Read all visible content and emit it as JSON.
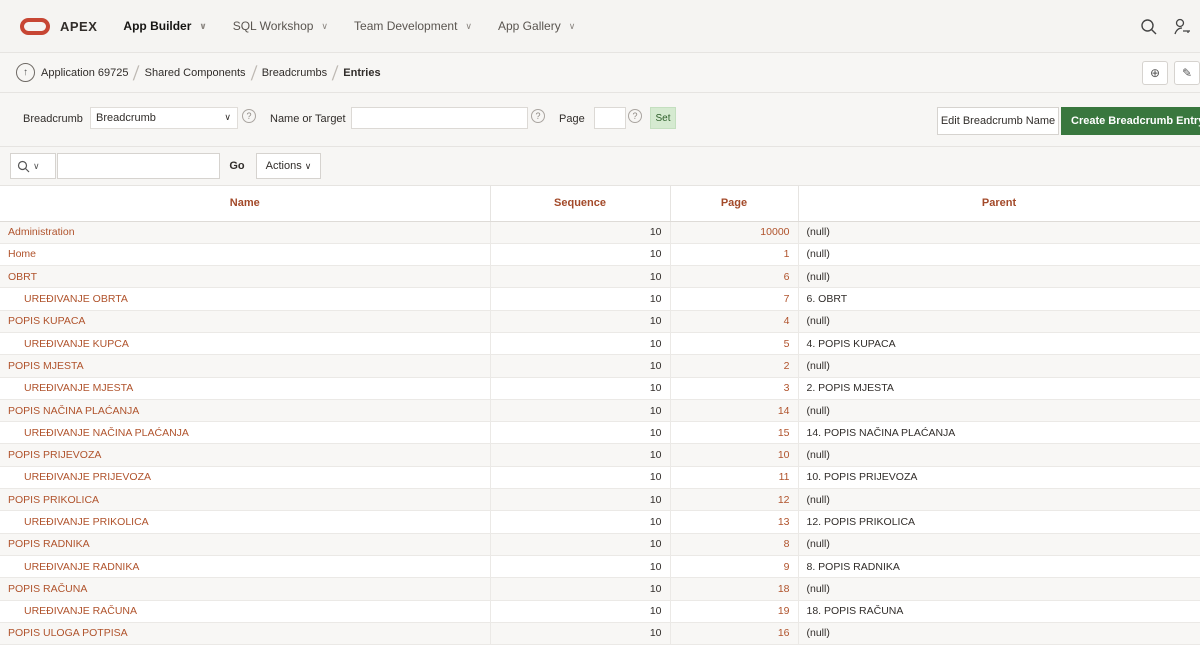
{
  "topnav": {
    "logo": "APEX",
    "items": [
      {
        "label": "App Builder",
        "active": true
      },
      {
        "label": "SQL Workshop",
        "active": false
      },
      {
        "label": "Team Development",
        "active": false
      },
      {
        "label": "App Gallery",
        "active": false
      }
    ]
  },
  "breadcrumb": {
    "items": [
      "Application 69725",
      "Shared Components",
      "Breadcrumbs",
      "Entries"
    ]
  },
  "filters": {
    "breadcrumb_label": "Breadcrumb",
    "breadcrumb_value": "Breadcrumb",
    "name_target_label": "Name or Target",
    "name_target_value": "",
    "page_label": "Page",
    "page_value": "",
    "set_label": "Set",
    "help_glyph": "?",
    "edit_button": "Edit Breadcrumb Name",
    "create_button": "Create Breadcrumb Entry >"
  },
  "search": {
    "value": "",
    "go_label": "Go",
    "actions_label": "Actions"
  },
  "table": {
    "columns": [
      "Name",
      "Sequence",
      "Page",
      "Parent"
    ],
    "rows": [
      {
        "name": "Administration",
        "child": false,
        "sequence": "10",
        "page": "10000",
        "parent": "(null)"
      },
      {
        "name": "Home",
        "child": false,
        "sequence": "10",
        "page": "1",
        "parent": "(null)"
      },
      {
        "name": "OBRT",
        "child": false,
        "sequence": "10",
        "page": "6",
        "parent": "(null)"
      },
      {
        "name": "UREĐIVANJE OBRTA",
        "child": true,
        "sequence": "10",
        "page": "7",
        "parent": "6. OBRT"
      },
      {
        "name": "POPIS KUPACA",
        "child": false,
        "sequence": "10",
        "page": "4",
        "parent": "(null)"
      },
      {
        "name": "UREĐIVANJE KUPCA",
        "child": true,
        "sequence": "10",
        "page": "5",
        "parent": "4. POPIS KUPACA"
      },
      {
        "name": "POPIS MJESTA",
        "child": false,
        "sequence": "10",
        "page": "2",
        "parent": "(null)"
      },
      {
        "name": "UREĐIVANJE MJESTA",
        "child": true,
        "sequence": "10",
        "page": "3",
        "parent": "2. POPIS MJESTA"
      },
      {
        "name": "POPIS NAČINA PLAĆANJA",
        "child": false,
        "sequence": "10",
        "page": "14",
        "parent": "(null)"
      },
      {
        "name": "UREĐIVANJE NAČINA PLAĆANJA",
        "child": true,
        "sequence": "10",
        "page": "15",
        "parent": "14. POPIS NAČINA PLAĆANJA"
      },
      {
        "name": "POPIS PRIJEVOZA",
        "child": false,
        "sequence": "10",
        "page": "10",
        "parent": "(null)"
      },
      {
        "name": "UREĐIVANJE PRIJEVOZA",
        "child": true,
        "sequence": "10",
        "page": "11",
        "parent": "10. POPIS PRIJEVOZA"
      },
      {
        "name": "POPIS PRIKOLICA",
        "child": false,
        "sequence": "10",
        "page": "12",
        "parent": "(null)"
      },
      {
        "name": "UREĐIVANJE PRIKOLICA",
        "child": true,
        "sequence": "10",
        "page": "13",
        "parent": "12. POPIS PRIKOLICA"
      },
      {
        "name": "POPIS RADNIKA",
        "child": false,
        "sequence": "10",
        "page": "8",
        "parent": "(null)"
      },
      {
        "name": "UREĐIVANJE RADNIKA",
        "child": true,
        "sequence": "10",
        "page": "9",
        "parent": "8. POPIS RADNIKA"
      },
      {
        "name": "POPIS RAČUNA",
        "child": false,
        "sequence": "10",
        "page": "18",
        "parent": "(null)"
      },
      {
        "name": "UREĐIVANJE RAČUNA",
        "child": true,
        "sequence": "10",
        "page": "19",
        "parent": "18. POPIS RAČUNA"
      },
      {
        "name": "POPIS ULOGA POTPISA",
        "child": false,
        "sequence": "10",
        "page": "16",
        "parent": "(null)"
      }
    ]
  },
  "icons": {
    "logo": "oracle-logo-icon",
    "search": "search-icon",
    "user": "user-key-icon",
    "up": "up-arrow-icon",
    "add": "add-comment-icon",
    "edit": "pencil-icon",
    "chevron": "chevron-down-icon",
    "help": "help-icon"
  },
  "colors": {
    "brand": "#c74634",
    "link": "#b0532c",
    "primary_button": "#39773e"
  }
}
